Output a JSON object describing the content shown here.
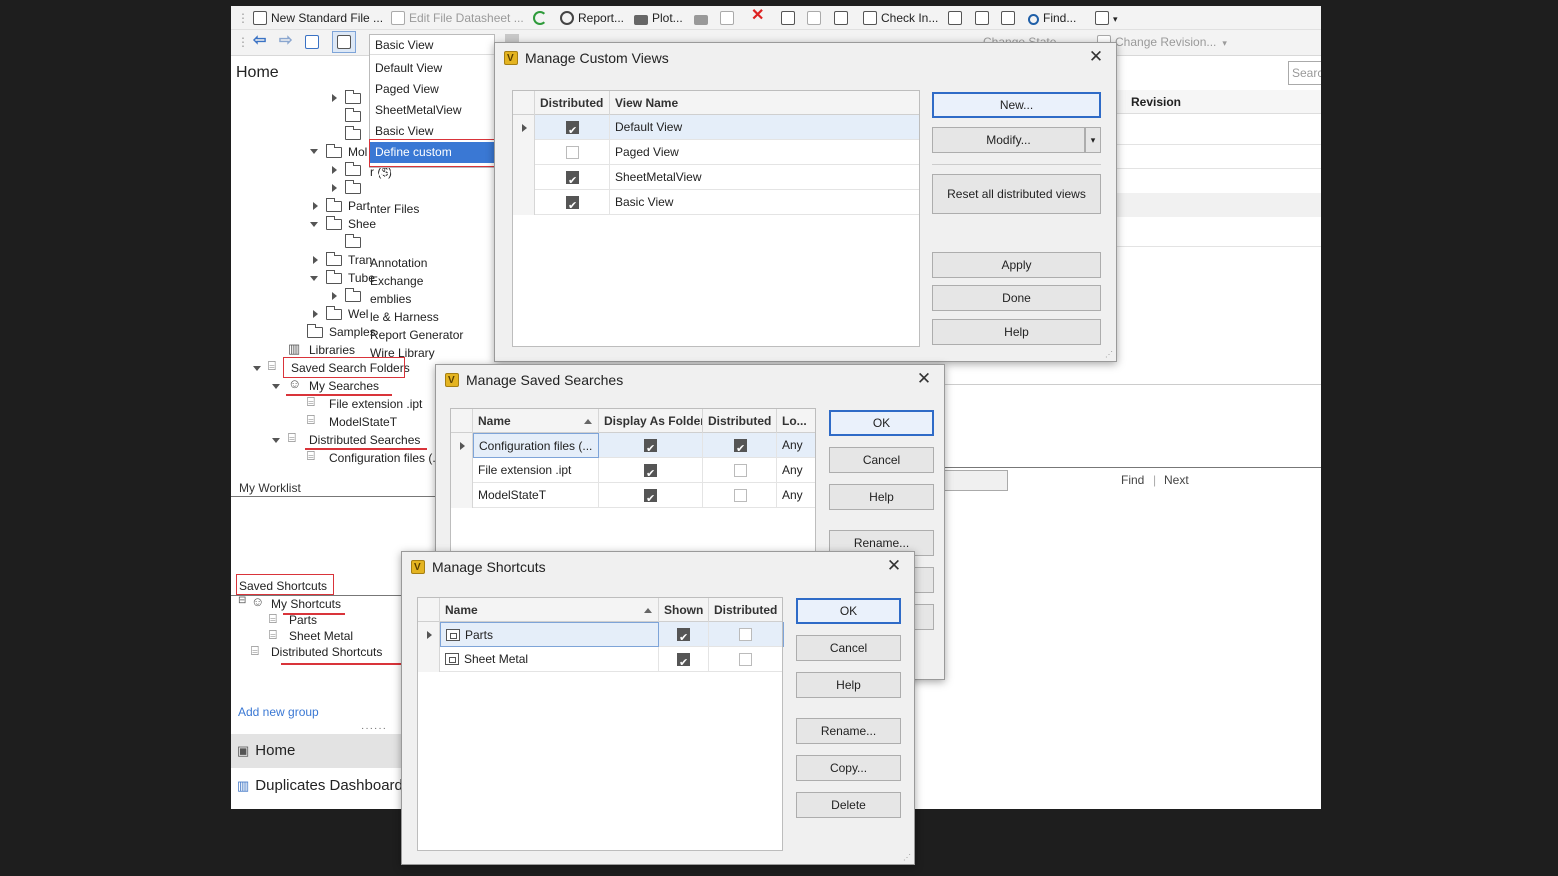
{
  "toolbar": {
    "new_standard_file": "New Standard File ...",
    "edit_file_datasheet": "Edit File Datasheet ...",
    "report": "Report...",
    "plot": "Plot...",
    "check_in": "Check In...",
    "find": "Find...",
    "change_state": "Change State",
    "change_revision": "Change Revision..."
  },
  "view_selector": {
    "current": "Basic View",
    "options": [
      "Default View",
      "Paged View",
      "SheetMetalView",
      "Basic View",
      "Define custom views..."
    ]
  },
  "left_panel": {
    "home_title": "Home",
    "search_placeholder": "Search",
    "tree": {
      "mold_folder": "Mol",
      "sub_folder": "r ($)",
      "parts_folder": "Part",
      "inter_files": "nter Files",
      "sheet_folder": "Shee",
      "tran_folder": "Tran",
      "annotation": "Annotation",
      "tube_folder": "Tube",
      "exchange": "Exchange",
      "assemblies": "emblies",
      "wel_folder": "Wel",
      "cable_harness": "le & Harness",
      "samples": "Samples",
      "report_generator": "Report Generator",
      "libraries": "Libraries",
      "wire_library": "Wire Library",
      "saved_search_folders": "Saved Search Folders",
      "my_searches": "My Searches",
      "file_extension_ipt": "File extension .ipt",
      "model_state_t": "ModelStateT",
      "distributed_searches": "Distributed Searches",
      "configuration_files": "Configuration files (.c"
    },
    "my_worklist": "My Worklist",
    "saved_shortcuts": "Saved Shortcuts",
    "shortcuts_tree": {
      "my_shortcuts": "My Shortcuts",
      "parts": "Parts",
      "sheet_metal": "Sheet Metal",
      "distributed_shortcuts": "Distributed Shortcuts"
    },
    "add_new_group": "Add new group",
    "nav_home": "Home",
    "nav_duplicates": "Duplicates Dashboard"
  },
  "background_grid": {
    "revision_header": "Revision",
    "find_label": "Find",
    "next_label": "Next"
  },
  "custom_views_dialog": {
    "title": "Manage Custom Views",
    "columns": [
      "Distributed",
      "View Name"
    ],
    "rows": [
      {
        "distributed": true,
        "name": "Default View"
      },
      {
        "distributed": false,
        "name": "Paged View"
      },
      {
        "distributed": true,
        "name": "SheetMetalView"
      },
      {
        "distributed": true,
        "name": "Basic View"
      }
    ],
    "buttons": {
      "new": "New...",
      "modify": "Modify...",
      "reset": "Reset all distributed views",
      "apply": "Apply",
      "done": "Done",
      "help": "Help"
    }
  },
  "saved_searches_dialog": {
    "title": "Manage Saved Searches",
    "columns": [
      "Name",
      "Display As Folder",
      "Distributed",
      "Lo..."
    ],
    "rows": [
      {
        "name": "Configuration files (...",
        "display_as_folder": true,
        "distributed": true,
        "location": "Any"
      },
      {
        "name": "File extension .ipt",
        "display_as_folder": true,
        "distributed": false,
        "location": "Any"
      },
      {
        "name": "ModelStateT",
        "display_as_folder": true,
        "distributed": false,
        "location": "Any"
      }
    ],
    "buttons": {
      "ok": "OK",
      "cancel": "Cancel",
      "help": "Help",
      "rename": "Rename..."
    }
  },
  "shortcuts_dialog": {
    "title": "Manage Shortcuts",
    "columns": [
      "Name",
      "Shown",
      "Distributed"
    ],
    "rows": [
      {
        "name": "Parts",
        "shown": true,
        "distributed": false
      },
      {
        "name": "Sheet Metal",
        "shown": true,
        "distributed": false
      }
    ],
    "buttons": {
      "ok": "OK",
      "cancel": "Cancel",
      "help": "Help",
      "rename": "Rename...",
      "copy": "Copy...",
      "delete": "Delete"
    }
  },
  "colors": {
    "accent": "#3a78d4",
    "annotation_red": "#d9343a",
    "link": "#3a78d4"
  }
}
